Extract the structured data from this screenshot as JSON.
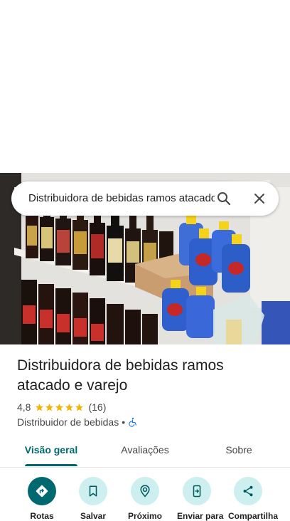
{
  "search": {
    "query": "Distribuidora de bebidas ramos atacado e varejo"
  },
  "place": {
    "title": "Distribuidora de bebidas ramos atacado e varejo",
    "rating": "4,8",
    "star_count": 5,
    "reviews_count": "(16)",
    "category": "Distribuidor de bebidas",
    "separator": "•"
  },
  "tabs": [
    {
      "label": "Visão geral",
      "selected": true
    },
    {
      "label": "Avaliações",
      "selected": false
    },
    {
      "label": "Sobre",
      "selected": false
    }
  ],
  "actions": [
    {
      "label": "Rotas",
      "icon": "directions-icon"
    },
    {
      "label": "Salvar",
      "icon": "bookmark-icon"
    },
    {
      "label": "Próximo",
      "icon": "nearby-icon"
    },
    {
      "label": "Enviar para",
      "icon": "send-to-phone-icon"
    },
    {
      "label": "Compartilha",
      "icon": "share-icon"
    }
  ],
  "colors": {
    "accent": "#00696f",
    "action_bg": "#cdeff0",
    "star": "#f5b400",
    "accessibility": "#1a73e8"
  }
}
